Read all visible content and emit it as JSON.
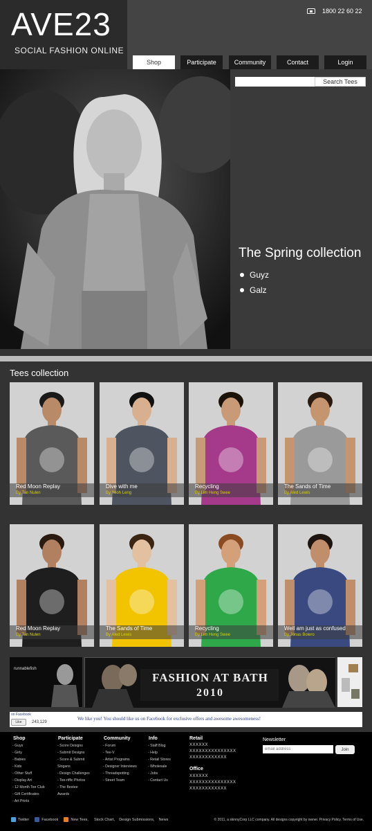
{
  "brand": {
    "title": "AVE23",
    "tagline": "SOCIAL FASHION ONLINE"
  },
  "phone": "1800 22 60 22",
  "nav": [
    "Shop",
    "Participate",
    "Community",
    "Contact",
    "Login"
  ],
  "search": {
    "placeholder": "",
    "button": "Search Tees"
  },
  "hero": {
    "collection_title": "The Spring collection",
    "items": [
      "Guyz",
      "Galz"
    ],
    "slides": 6,
    "active_slide": 1
  },
  "tees": {
    "title": "Tees collection",
    "cards": [
      {
        "name": "Red Moon Replay",
        "author": "By Tan Nulen"
      },
      {
        "name": "Dive with me",
        "author": "By Yeoh Leng"
      },
      {
        "name": "Recycling",
        "author": "By Lim Heng Swee"
      },
      {
        "name": "The Sands of Time",
        "author": "By Aled Lewis"
      },
      {
        "name": "Red Moon Replay",
        "author": "By Tan Nulen"
      },
      {
        "name": "The Sands of Time",
        "author": "By Aled Lewis"
      },
      {
        "name": "Recycling",
        "author": "By Lim Heng Swee"
      },
      {
        "name": "Well am just as confused",
        "author": "By Jonas Bolero"
      }
    ]
  },
  "banners": {
    "fashion_line1": "FASHION AT BATH",
    "fashion_line2": "2010",
    "left_logo": "runnablefish"
  },
  "facebook": {
    "small": "on Facebook",
    "like": "Like",
    "count": "243,129",
    "message": "We like you! You should like us on Facebook for exclusive offers and awesome awesomeness!"
  },
  "footer": {
    "shop": {
      "title": "Shop",
      "items": [
        "- Guys",
        "- Girly",
        "- Babies",
        "- Kids",
        "- Other Stuff",
        "- Display Art",
        "- 12 Month Tee Club",
        "- Gift Certificates",
        "- Art Prints"
      ]
    },
    "participate": {
      "title": "Participate",
      "items": [
        "- Score Designs",
        "- Submit Designs",
        "- Score & Submit",
        "  Slogans",
        "- Design Challenges",
        "- Tee-riffic Photos",
        "- The Bestee",
        "  Awards"
      ]
    },
    "community": {
      "title": "Community",
      "items": [
        "- Forum",
        "- Tee-V",
        "- Artist Programs",
        "- Designer Interviews",
        "- Threadspotting",
        "- Street Team"
      ]
    },
    "info": {
      "title": "Info",
      "items": [
        "- Staff Blog",
        "- Help",
        "- Retail Stores",
        "- Wholesale",
        "- Jobs",
        "- Contact Us"
      ]
    },
    "retail": {
      "title": "Retail",
      "lines": [
        "XXXXXX",
        "XXXXXXXXXXXXXXX",
        "XXXXXXXXXXXX"
      ]
    },
    "office": {
      "title": "Office",
      "lines": [
        "XXXXXX",
        "XXXXXXXXXXXXXXX",
        "XXXXXXXXXXXX"
      ]
    },
    "newsletter": {
      "title": "Newsletter",
      "placeholder": "email address",
      "button": "Join"
    },
    "social": [
      "Twitter",
      "Facebook",
      "New Tees,",
      "Stock Chart,",
      "Design Submissions,",
      "News"
    ],
    "copyright": "© 2011, a skinnyCorp LLC company. All designs copyright by owner. Privacy Policy. Terms of Use."
  },
  "colors": {
    "accent_yellow": "#d8d400",
    "fb_blue": "#2a3f8a"
  }
}
